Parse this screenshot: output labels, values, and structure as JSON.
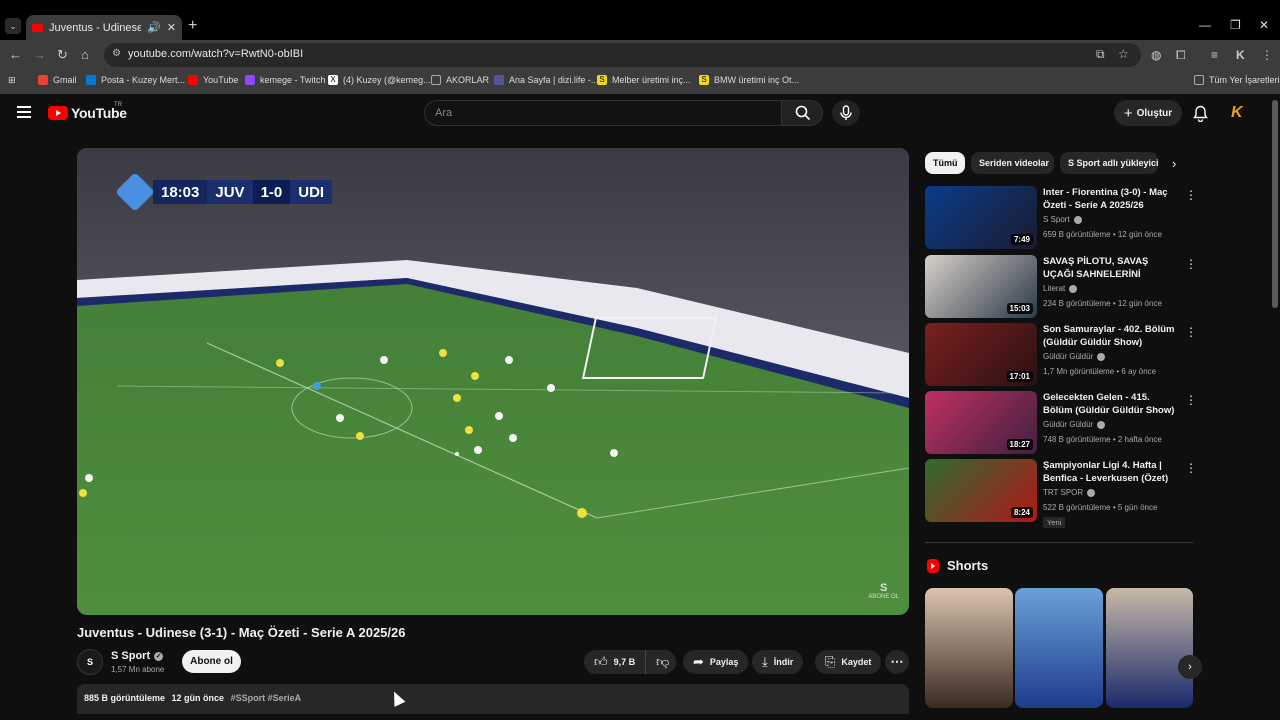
{
  "browser": {
    "tab": {
      "title": "Juventus - Udinese (3-1) - M"
    },
    "url": "youtube.com/watch?v=RwtN0-obIBI",
    "bookmarks": [
      {
        "label": "Gmail",
        "color": "#ea4335"
      },
      {
        "label": "Posta - Kuzey Mert...",
        "color": "#0078d4"
      },
      {
        "label": "YouTube",
        "color": "#ff0000"
      },
      {
        "label": "kemege - Twitch",
        "color": "#9146ff"
      },
      {
        "label": "(4) Kuzey (@kemeg...",
        "color": "#ffffff"
      },
      {
        "label": "AKORLAR",
        "color": "#aaaaaa"
      },
      {
        "label": "Ana Sayfa | dizi.life -...",
        "color": "#555599"
      },
      {
        "label": "Melber üretimi inç...",
        "color": "#f4d90e"
      },
      {
        "label": "BMW üretimi inç Ot...",
        "color": "#f4d90e"
      }
    ],
    "all_bookmarks": "Tüm Yer İşaretleri"
  },
  "youtube": {
    "region": "TR",
    "logo_text": "YouTube",
    "search_placeholder": "Ara",
    "create_label": "Oluştur",
    "overlay": {
      "time": "18:03",
      "home": "JUV",
      "score": "1-0",
      "away": "UDI"
    },
    "watermark": "ABONE OL",
    "video": {
      "title": "Juventus - Udinese (3-1) - Maç Özeti - Serie A 2025/26",
      "channel": "S Sport",
      "channel_initial": "S",
      "subscribers": "1,57 Mn abone",
      "subscribe_label": "Abone ol",
      "likes": "9,7 B",
      "share_label": "Paylaş",
      "download_label": "İndir",
      "save_label": "Kaydet",
      "views": "885 B görüntüleme",
      "ago": "12 gün önce",
      "tags": "#SSport #SerieA"
    },
    "chips": [
      {
        "label": "Tümü",
        "active": true
      },
      {
        "label": "Seriden videolar",
        "active": false
      },
      {
        "label": "S Sport adlı yükleyici",
        "active": false
      }
    ],
    "recommendations": [
      {
        "title": "Inter - Fiorentina (3-0) - Maç Özeti - Serie A 2025/26",
        "channel": "S Sport",
        "meta": "659 B görüntüleme • 12 gün önce",
        "duration": "7:49",
        "thumb_colors": [
          "#0a3d8a",
          "#1a1a2e"
        ]
      },
      {
        "title": "SAVAŞ PİLOTU, SAVAŞ UÇAĞI SAHNELERİNİ İZLİYOR! (YENİ ...",
        "channel": "Literat",
        "meta": "234 B görüntüleme • 12 gün önce",
        "duration": "15:03",
        "thumb_colors": [
          "#d8d0c8",
          "#2b3a4a"
        ]
      },
      {
        "title": "Son Samuraylar - 402. Bölüm (Güldür Güldür Show)",
        "channel": "Güldür Güldür",
        "meta": "1,7 Mn görüntüleme • 6 ay önce",
        "duration": "17:01",
        "thumb_colors": [
          "#7a2020",
          "#2a1010"
        ]
      },
      {
        "title": "Gelecekten Gelen - 415. Bölüm (Güldür Güldür Show)",
        "channel": "Güldür Güldür",
        "meta": "748 B görüntüleme • 2 hafta önce",
        "duration": "18:27",
        "thumb_colors": [
          "#c03060",
          "#402040"
        ]
      },
      {
        "title": "Şampiyonlar Ligi 4. Hafta | Benfica - Leverkusen (Özet)",
        "channel": "TRT SPOR",
        "meta": "522 B görüntüleme • 5 gün önce",
        "duration": "8:24",
        "badge": "Yeni",
        "thumb_colors": [
          "#2e6b2e",
          "#b01818"
        ]
      }
    ],
    "shorts_label": "Shorts",
    "shorts": [
      {
        "colors": [
          "#d9c4b0",
          "#3a2a20"
        ]
      },
      {
        "colors": [
          "#6aa0d8",
          "#1e3c8c"
        ]
      },
      {
        "colors": [
          "#c8b8a8",
          "#1a2a6a"
        ]
      }
    ]
  }
}
